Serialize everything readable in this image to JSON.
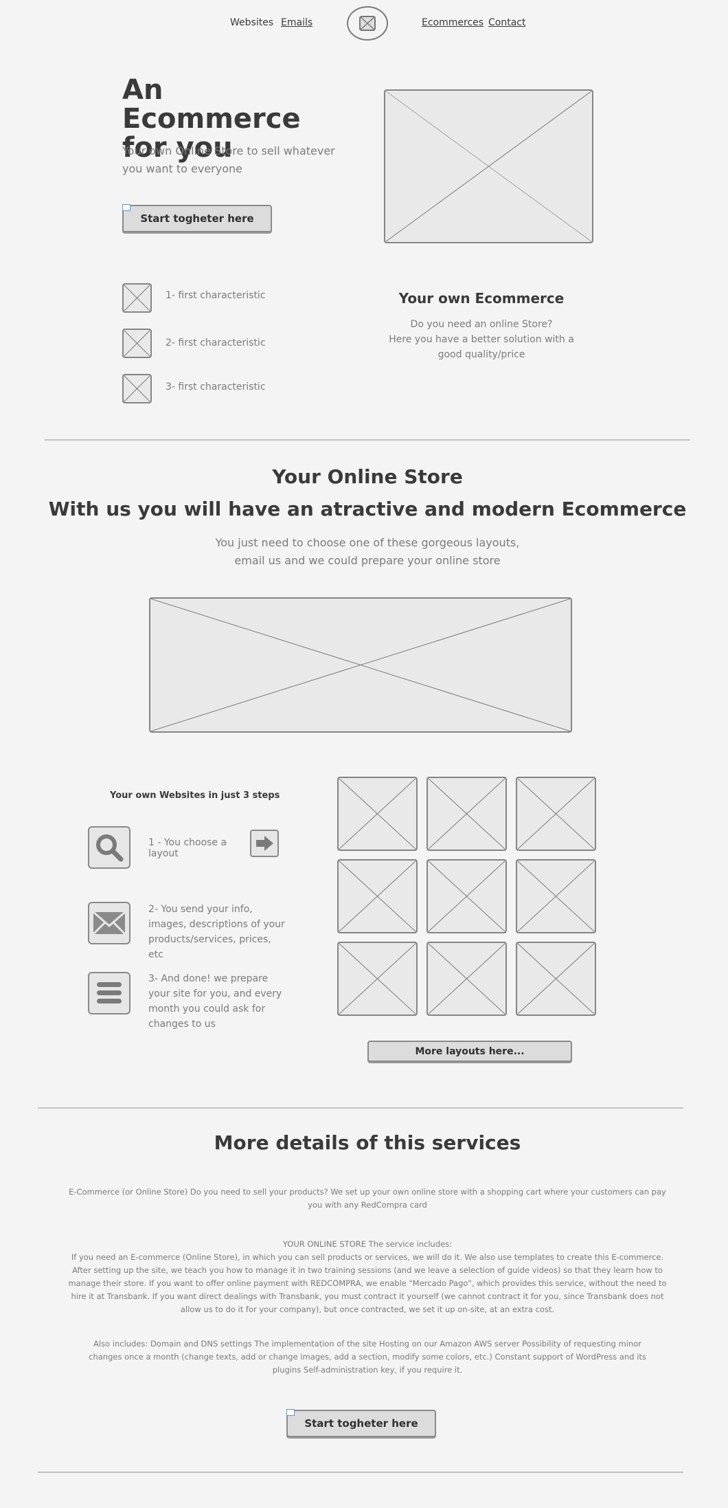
{
  "nav": {
    "websites": "Websites",
    "emails": "Emails",
    "ecommerces": "Ecommerces",
    "contact": "Contact"
  },
  "hero": {
    "title": "An Ecommerce for you",
    "subtitle": "Your own Online Store to sell whatever you want to everyone",
    "cta": "Start togheter here"
  },
  "features": [
    "1- first characteristic",
    "2- first characteristic",
    "3- first characteristic"
  ],
  "own_ecommerce": {
    "title": "Your own Ecommerce",
    "line1": "Do you need an online Store?",
    "line2": "Here you have a better solution with a good quality/price"
  },
  "online_store": {
    "title": "Your Online Store",
    "headline": "With us you will have an atractive and modern Ecommerce",
    "subtitle": "You just need to choose one of these gorgeous layouts, email us and we could prepare your online store"
  },
  "steps": {
    "title": "Your own Websites in just 3 steps",
    "items": [
      "1 - You choose a layout",
      "2- You send your info, images, descriptions of your products/services, prices, etc",
      "3- And done! we prepare your site for you, and every month you could ask for changes to us"
    ]
  },
  "more_layouts": "More layouts here...",
  "details": {
    "title": "More details of this services",
    "p1": "E-Commerce (or Online Store) Do you need to sell your products? We set up your own online store with a shopping cart where your customers can pay you with any RedCompra card",
    "p2_head": "YOUR ONLINE STORE The service includes:",
    "p2": "If you need an E-commerce (Online Store), in which you can sell products or services, we will do it. We also use templates to create this E-commerce. After setting up the site, we teach you how to manage it in two training sessions (and we leave a selection of guide videos) so that they learn how to manage their store. If you want to offer online payment with REDCOMPRA, we enable \"Mercado Pago\", which provides this service, without the need to hire it at Transbank. If you want direct dealings with Transbank, you must contract it yourself (we cannot contract it for you, since Transbank does not allow us to do it for your company), but once contracted, we set it up on-site, at an extra cost.",
    "p3": "Also includes: Domain and DNS settings The implementation of the site Hosting on our Amazon AWS server Possibility of requesting minor changes once a month (change texts, add or change images, add a section, modify some colors, etc.) Constant support of WordPress and its plugins Self-administration key, if you require it.",
    "cta": "Start togheter here"
  },
  "icons": {
    "logo": "envelope-x-icon",
    "feature": "image-placeholder-icon",
    "step1": "search-icon",
    "step1_arrow": "arrow-right-icon",
    "step2": "envelope-icon",
    "step3": "menu-icon"
  }
}
